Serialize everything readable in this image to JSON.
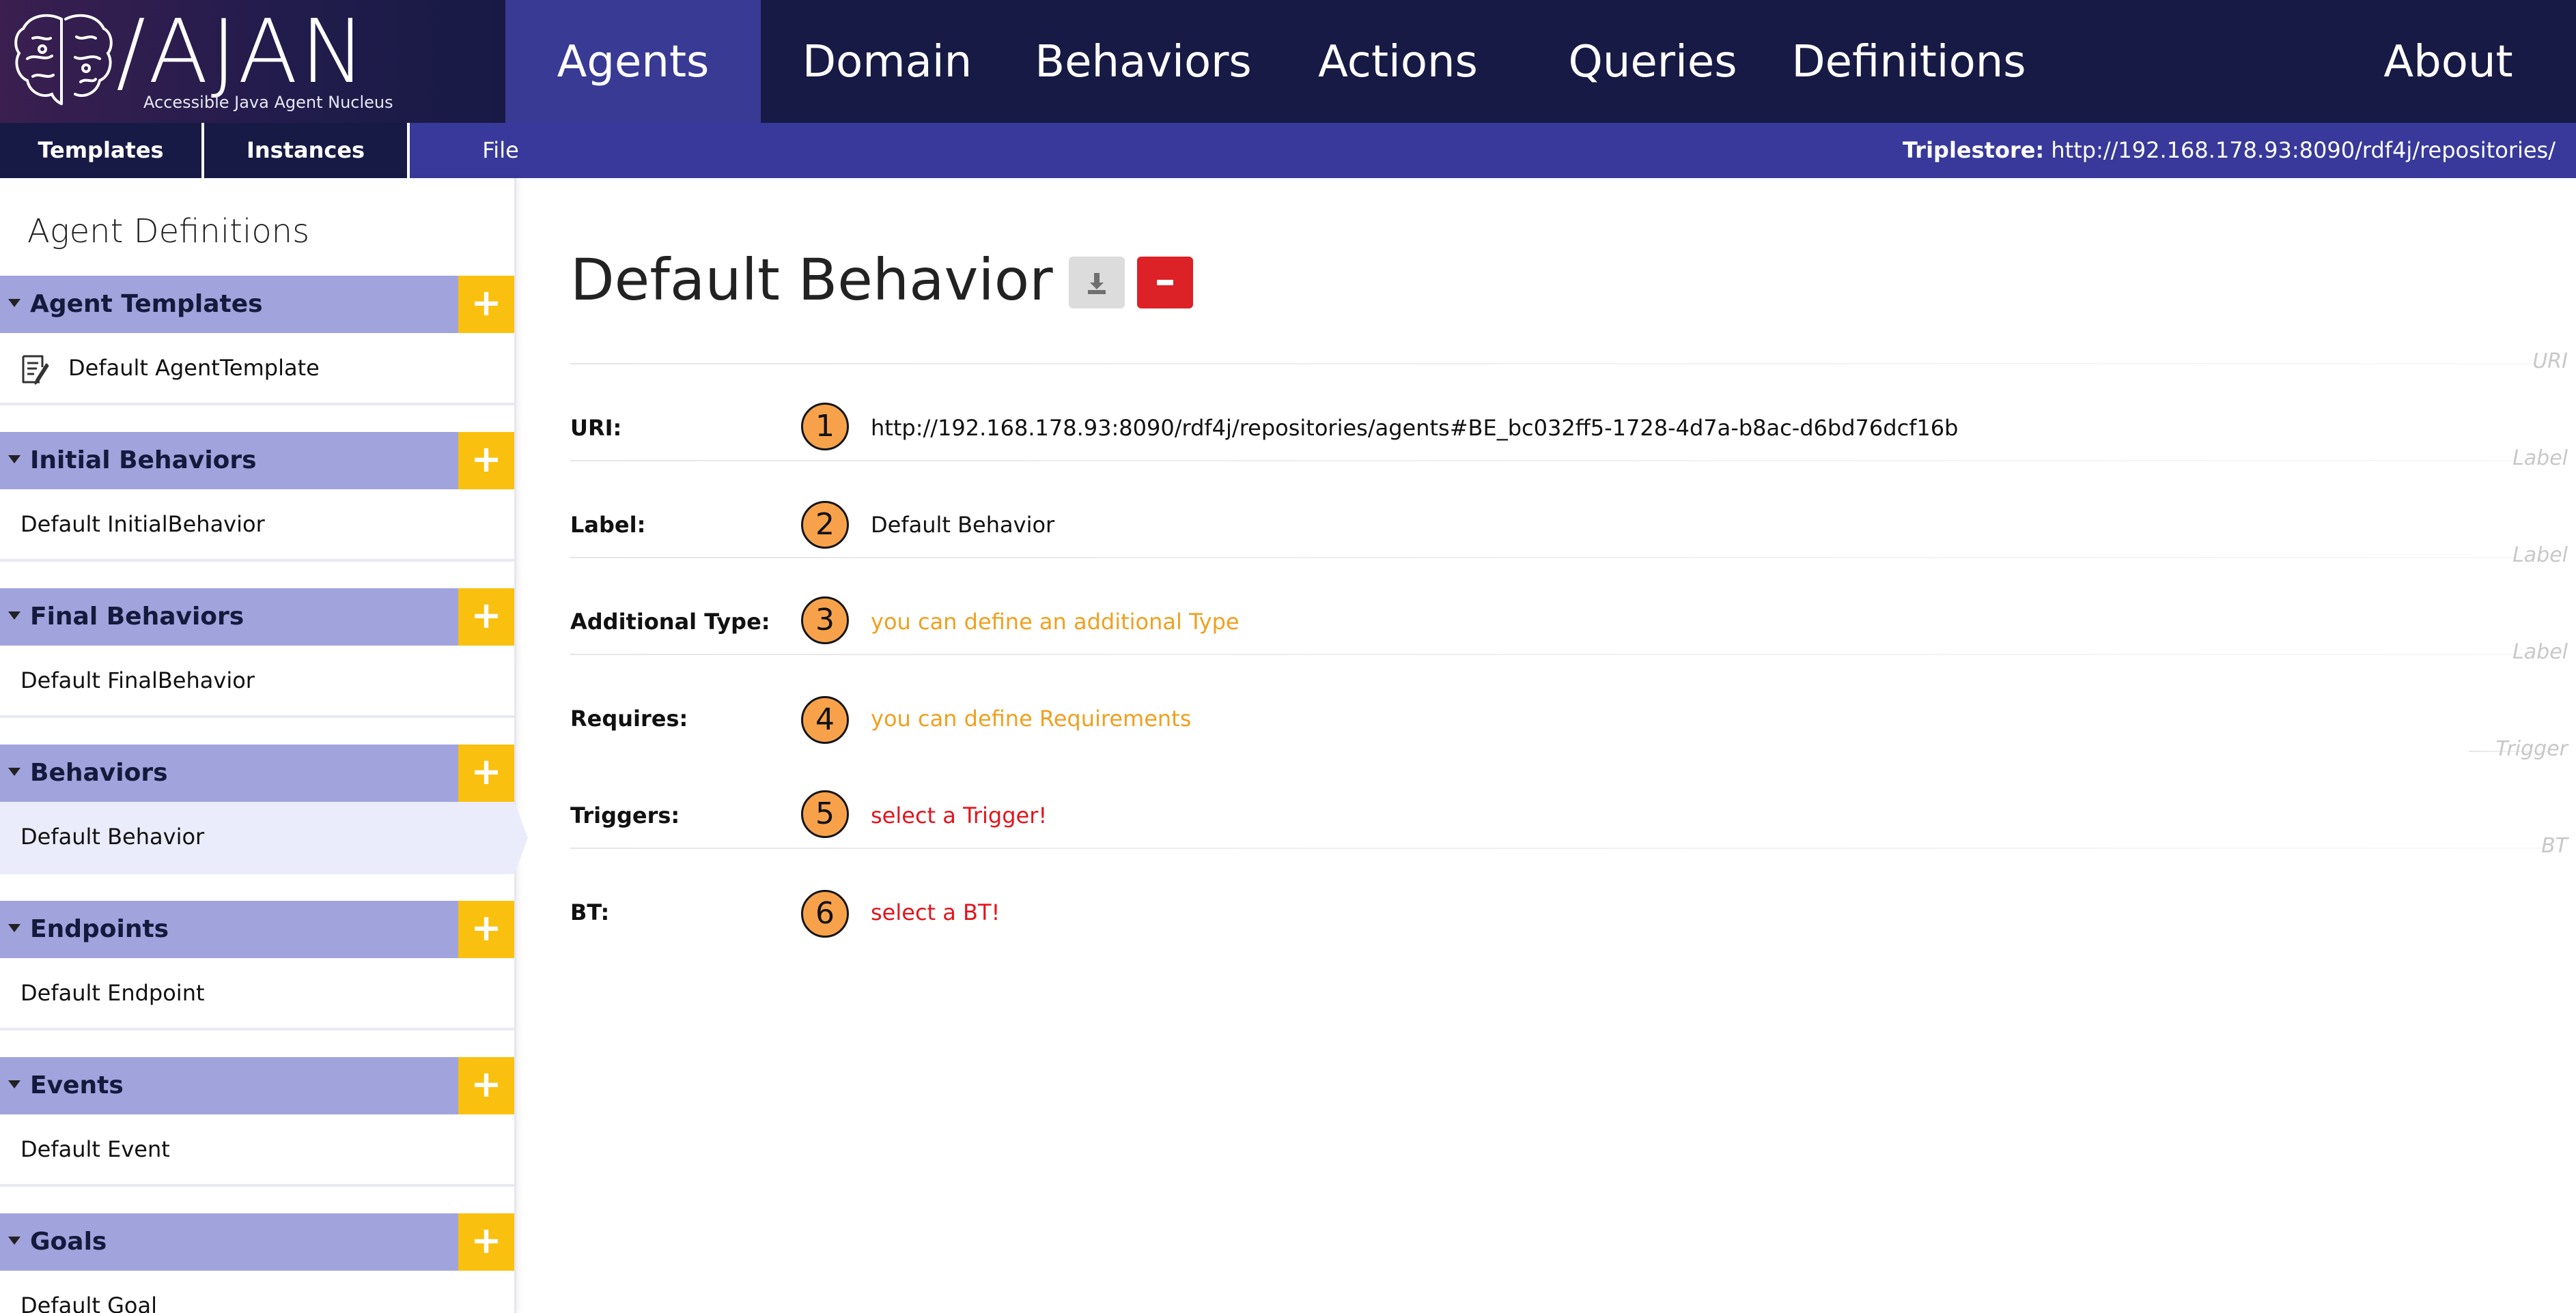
{
  "app": {
    "logo_title": "/AJAN",
    "logo_subtitle": "Accessible Java Agent Nucleus"
  },
  "nav": {
    "items": [
      {
        "label": "Agents",
        "active": true
      },
      {
        "label": "Domain"
      },
      {
        "label": "Behaviors"
      },
      {
        "label": "Actions"
      },
      {
        "label": "Queries"
      },
      {
        "label": "Definitions"
      },
      {
        "label": "About"
      }
    ]
  },
  "subnav": {
    "tabs": [
      {
        "label": "Templates",
        "active": true
      },
      {
        "label": "Instances"
      },
      {
        "label": "File"
      }
    ],
    "triplestore_label": "Triplestore:",
    "triplestore_url": "http://192.168.178.93:8090/rdf4j/repositories/"
  },
  "sidebar": {
    "title": "Agent Definitions",
    "sections": [
      {
        "label": "Agent Templates",
        "add": "+",
        "item": "Default AgentTemplate",
        "item_icon": "template-icon"
      },
      {
        "label": "Initial Behaviors",
        "add": "+",
        "item": "Default InitialBehavior"
      },
      {
        "label": "Final Behaviors",
        "add": "+",
        "item": "Default FinalBehavior"
      },
      {
        "label": "Behaviors",
        "add": "+",
        "item": "Default Behavior",
        "active": true
      },
      {
        "label": "Endpoints",
        "add": "+",
        "item": "Default Endpoint"
      },
      {
        "label": "Events",
        "add": "+",
        "item": "Default Event"
      },
      {
        "label": "Goals",
        "add": "+",
        "item": "Default Goal"
      }
    ]
  },
  "main": {
    "title": "Default Behavior",
    "fields": [
      {
        "hint": "URI",
        "label": "URI:",
        "number": "1",
        "value": "http://192.168.178.93:8090/rdf4j/repositories/agents#BE_bc032ff5-1728-4d7a-b8ac-d6bd76dcf16b",
        "color": "#111111"
      },
      {
        "hint": "Label",
        "label": "Label:",
        "number": "2",
        "value": "Default Behavior",
        "color": "#111111"
      },
      {
        "hint": "Label",
        "label": "Additional Type:",
        "number": "3",
        "value": "you can define an additional Type",
        "color": "#f0a01e"
      },
      {
        "hint": "Label",
        "label": "Requires:",
        "number": "4",
        "value": "you can define Requirements",
        "color": "#f0a01e"
      },
      {
        "hint": "Trigger",
        "label": "Triggers:",
        "number": "5",
        "value": "select a Trigger!",
        "color": "#e3141c"
      },
      {
        "hint": "BT",
        "label": "BT:",
        "number": "6",
        "value": "select a BT!",
        "color": "#e3141c"
      }
    ]
  },
  "colors": {
    "nav_bg": "#171a45",
    "nav_active": "#383a94",
    "section_header": "#a0a3dc",
    "add_button": "#f9c00f",
    "delete_button": "#dc2127",
    "number_badge": "#f7a24b"
  }
}
